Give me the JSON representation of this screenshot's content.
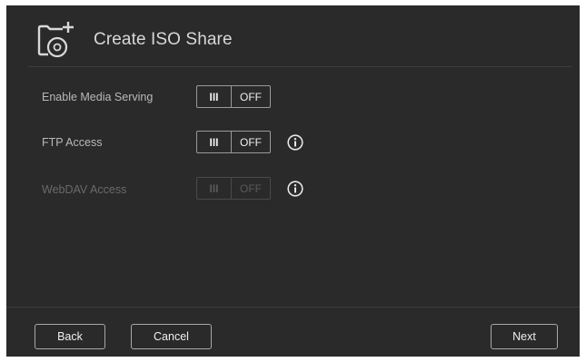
{
  "dialog": {
    "title": "Create ISO Share",
    "icon": "iso-share-add-icon"
  },
  "settings": [
    {
      "label": "Enable Media Serving",
      "on_label": "III",
      "off_label": "OFF",
      "state": "off",
      "enabled": true,
      "info": false
    },
    {
      "label": "FTP Access",
      "on_label": "III",
      "off_label": "OFF",
      "state": "off",
      "enabled": true,
      "info": true
    },
    {
      "label": "WebDAV Access",
      "on_label": "III",
      "off_label": "OFF",
      "state": "off",
      "enabled": false,
      "info": true
    }
  ],
  "footer": {
    "back_label": "Back",
    "cancel_label": "Cancel",
    "next_label": "Next"
  },
  "colors": {
    "background": "#2a2a2a",
    "text": "#b9b9b9",
    "disabled_text": "#6a6a6a",
    "border": "#9a9a9a"
  }
}
